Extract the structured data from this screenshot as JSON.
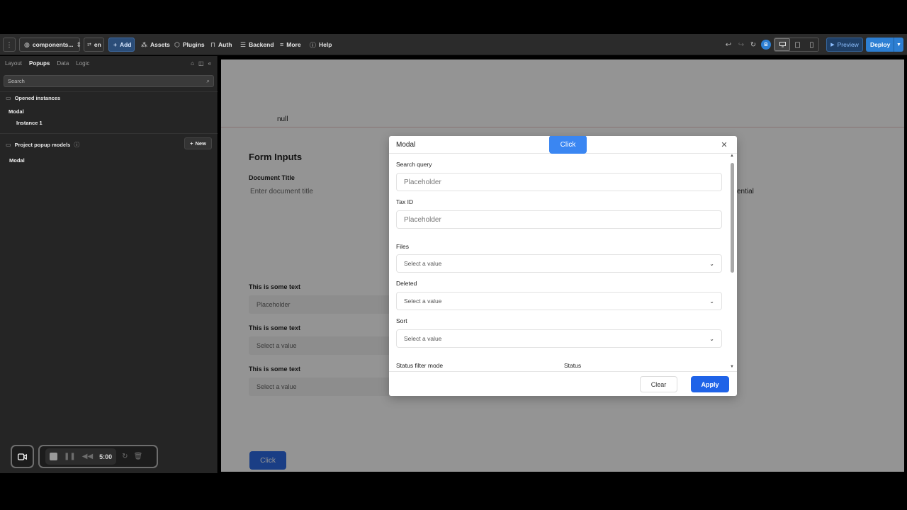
{
  "toolbar": {
    "project_name": "components...",
    "language": "en",
    "add_label": "Add",
    "assets_label": "Assets",
    "plugins_label": "Plugins",
    "auth_label": "Auth",
    "backend_label": "Backend",
    "more_label": "More",
    "help_label": "Help",
    "avatar_initial": "B",
    "preview_label": "Preview",
    "deploy_label": "Deploy"
  },
  "sidebar": {
    "tabs": [
      "Layout",
      "Popups",
      "Data",
      "Logic"
    ],
    "active_tab": "Popups",
    "search_placeholder": "Search",
    "opened_instances_title": "Opened instances",
    "opened_item": "Modal",
    "opened_sub_item": "Instance 1",
    "project_models_title": "Project popup models",
    "new_label": "New",
    "model_item": "Modal"
  },
  "recorder": {
    "time": "5:00"
  },
  "canvas": {
    "null_text": "null",
    "form_title": "Form Inputs",
    "document_title_label": "Document Title",
    "document_title_placeholder": "Enter document title",
    "partial_text": "ential",
    "text_1": "This is some text",
    "field_1_placeholder": "Placeholder",
    "text_2": "This is some text",
    "field_2_placeholder": "Select a value",
    "text_3": "This is some text",
    "field_3_placeholder": "Select a value",
    "click_label": "Click"
  },
  "modal": {
    "title": "Modal",
    "click_label": "Click",
    "search_query_label": "Search query",
    "search_query_placeholder": "Placeholder",
    "tax_id_label": "Tax ID",
    "tax_id_placeholder": "Placeholder",
    "files_label": "Files",
    "files_value": "Select a value",
    "deleted_label": "Deleted",
    "deleted_value": "Select a value",
    "sort_label": "Sort",
    "sort_value": "Select a value",
    "status_filter_mode_label": "Status filter mode",
    "status_label": "Status",
    "clear_label": "Clear",
    "apply_label": "Apply"
  },
  "colors": {
    "accent": "#2d7fd3",
    "apply_button": "#1f63e8",
    "sidebar_bg": "#252525",
    "toolbar_bg": "#2b2b2b"
  }
}
